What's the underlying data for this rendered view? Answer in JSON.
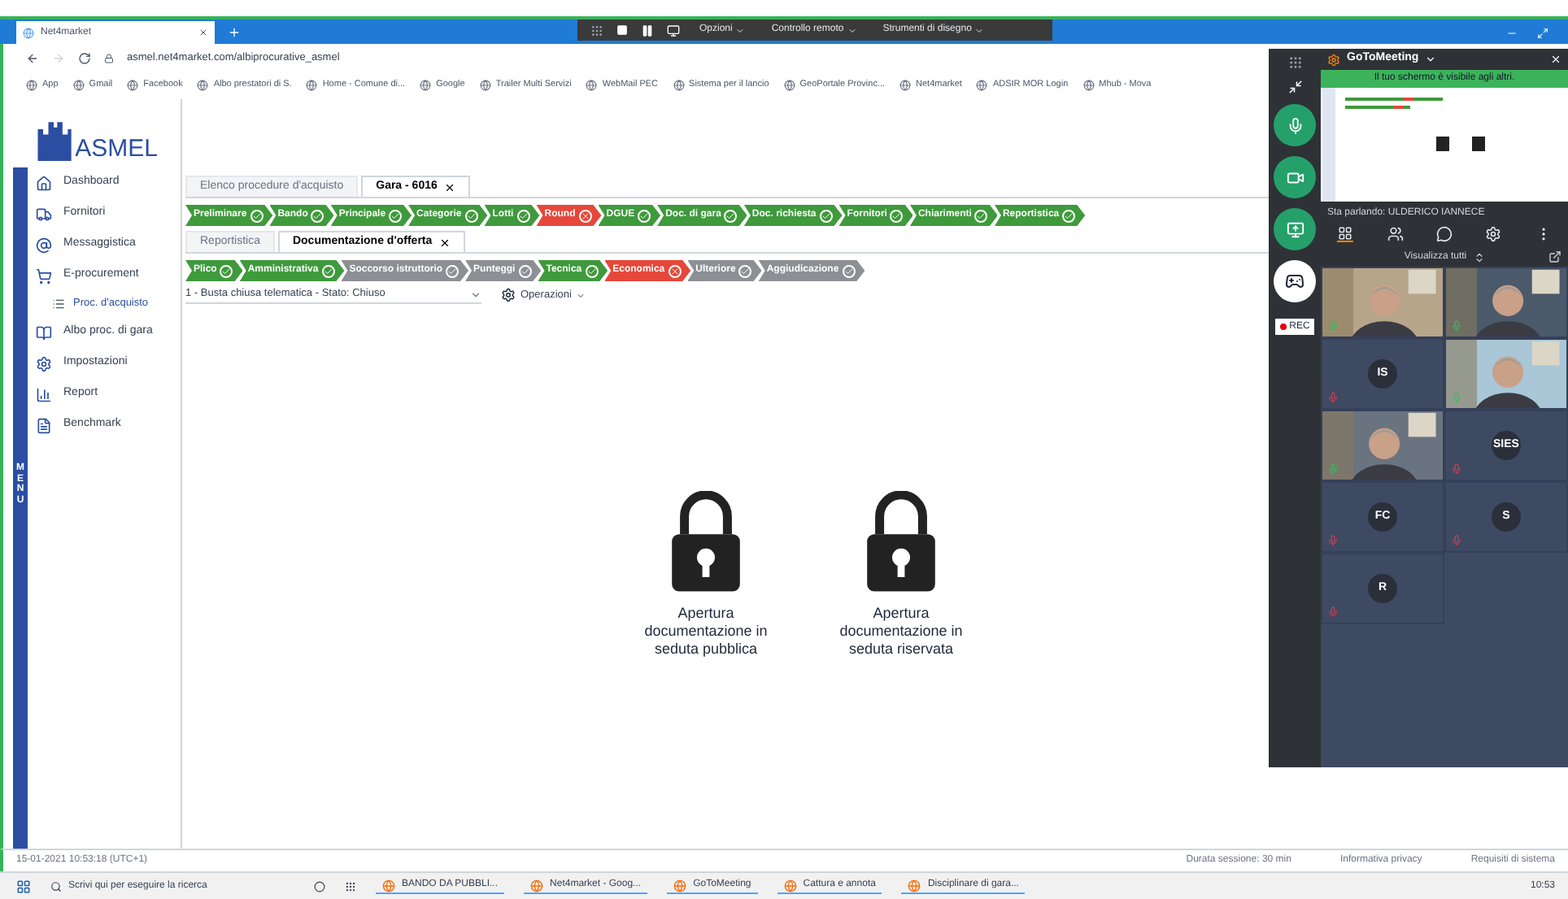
{
  "browser": {
    "tab_title": "Net4market",
    "url": "asmel.net4market.com/albiprocurative_asmel",
    "bookmarks": [
      "App",
      "Gmail",
      "Facebook",
      "Albo prestatori di S.",
      "Home - Comune di...",
      "Google",
      "Trailer Multi Servizi",
      "WebMail PEC",
      "Sistema per il lancio",
      "GeoPortale Provinc...",
      "Net4market",
      "ADSIR MOR Login",
      "Mhub - Mova"
    ],
    "remote_toolbar": [
      "Opzioni",
      "Controllo remoto",
      "Strumenti di disegno"
    ]
  },
  "sidebar": {
    "logo": "ASMEL",
    "menu_label": "MENU",
    "items": [
      {
        "label": "Dashboard"
      },
      {
        "label": "Fornitori"
      },
      {
        "label": "Messaggistica"
      },
      {
        "label": "E-procurement",
        "children": [
          {
            "label": "Proc. d'acquisto"
          }
        ]
      },
      {
        "label": "Albo proc. di gara"
      },
      {
        "label": "Impostazioni"
      },
      {
        "label": "Report"
      },
      {
        "label": "Benchmark"
      }
    ]
  },
  "main": {
    "tabs": [
      {
        "label": "Elenco procedure d'acquisto",
        "selected": false,
        "closable": false
      },
      {
        "label": "Gara - 6016",
        "selected": true,
        "closable": true
      }
    ],
    "steps": [
      {
        "label": "Preliminare",
        "kind": "done"
      },
      {
        "label": "Bando",
        "kind": "done"
      },
      {
        "label": "Principale",
        "kind": "done"
      },
      {
        "label": "Categorie",
        "kind": "done"
      },
      {
        "label": "Lotti",
        "kind": "done"
      },
      {
        "label": "Round",
        "kind": "error"
      },
      {
        "label": "DGUE",
        "kind": "done"
      },
      {
        "label": "Doc. di gara",
        "kind": "done"
      },
      {
        "label": "Doc. richiesta",
        "kind": "done"
      },
      {
        "label": "Fornitori",
        "kind": "done"
      },
      {
        "label": "Chiarimenti",
        "kind": "done"
      },
      {
        "label": "Reportistica",
        "kind": "done"
      }
    ],
    "subtabs": [
      {
        "label": "Reportistica",
        "selected": false,
        "closable": false
      },
      {
        "label": "Documentazione d'offerta",
        "selected": true,
        "closable": true
      }
    ],
    "substeps": [
      {
        "label": "Plico",
        "kind": "done"
      },
      {
        "label": "Amministrativa",
        "kind": "done"
      },
      {
        "label": "Soccorso istruttorio",
        "kind": "pending"
      },
      {
        "label": "Punteggi",
        "kind": "pending"
      },
      {
        "label": "Tecnica",
        "kind": "done"
      },
      {
        "label": "Economica",
        "kind": "error"
      },
      {
        "label": "Ulteriore",
        "kind": "pending"
      },
      {
        "label": "Aggiudicazione",
        "kind": "pending"
      }
    ],
    "envelope_select": "1 - Busta chiusa telematica - Stato: Chiuso",
    "operations": "Operazioni",
    "locks": [
      {
        "caption": "Apertura documentazione in seduta pubblica"
      },
      {
        "caption": "Apertura documentazione in seduta riservata"
      }
    ]
  },
  "status_bar": {
    "timestamp": "15-01-2021 10:53:18 (UTC+1)",
    "session": "Durata sessione: 30 min",
    "links": [
      "Informativa privacy",
      "Requisiti di sistema"
    ]
  },
  "meeting": {
    "app_name": "GoToMeeting",
    "banner": "Il tuo schermo è visibile agli altri.",
    "speaking": "Sta parlando: ULDERICO IANNECE",
    "view_all": "Visualizza tutti",
    "rec": "REC",
    "tiles": [
      {
        "kind": "video",
        "muted": false
      },
      {
        "kind": "video",
        "muted": false
      },
      {
        "kind": "initials",
        "initials": "IS",
        "muted": true
      },
      {
        "kind": "video",
        "muted": false
      },
      {
        "kind": "video",
        "muted": false
      },
      {
        "kind": "initials",
        "initials": "SIES",
        "muted": true
      },
      {
        "kind": "initials",
        "initials": "FC",
        "muted": true
      },
      {
        "kind": "initials",
        "initials": "S",
        "muted": true
      },
      {
        "kind": "initials",
        "initials": "R",
        "muted": true
      }
    ]
  },
  "taskbar": {
    "search_placeholder": "Scrivi qui per eseguire la ricerca",
    "apps": [
      "BANDO DA PUBBLI...",
      "Net4market - Goog...",
      "GoToMeeting",
      "Cattura e annota",
      "Disciplinare di gara..."
    ],
    "time": "10:53"
  }
}
